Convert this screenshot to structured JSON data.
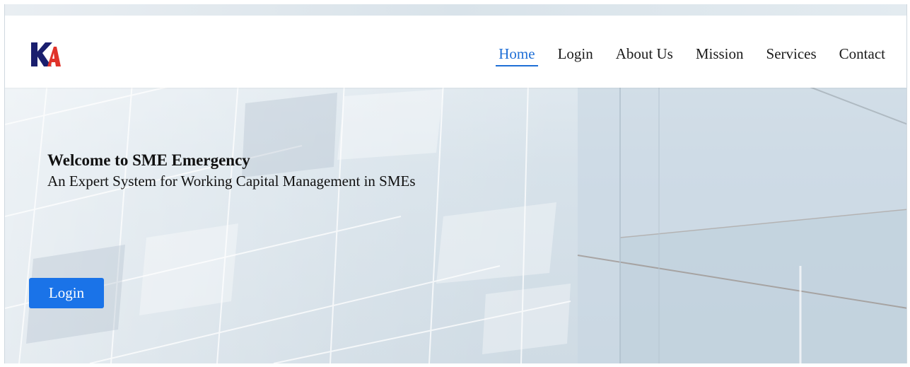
{
  "brand": {
    "logo_icon": "ka-logo-icon",
    "colors": {
      "dark": "#1a1f6e",
      "red": "#e0322a",
      "accent": "#1f6fd6"
    }
  },
  "nav": {
    "items": [
      {
        "label": "Home",
        "active": true
      },
      {
        "label": "Login",
        "active": false
      },
      {
        "label": "About Us",
        "active": false
      },
      {
        "label": "Mission",
        "active": false
      },
      {
        "label": "Services",
        "active": false
      },
      {
        "label": "Contact",
        "active": false
      }
    ]
  },
  "hero": {
    "title": "Welcome to SME Emergency",
    "subtitle": "An Expert System for Working Capital Management in SMEs",
    "login_label": "Login",
    "button_color": "#1a73e8"
  }
}
